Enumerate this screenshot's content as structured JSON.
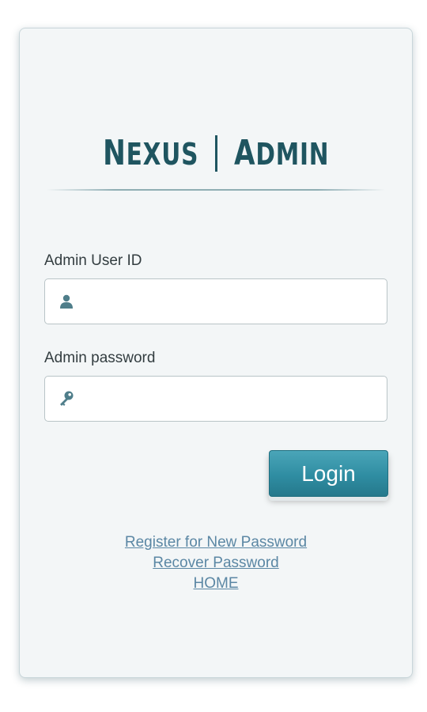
{
  "brand": {
    "first_initial": "N",
    "first_rest": "EXUS",
    "second_initial": "A",
    "second_rest": "DMIN"
  },
  "form": {
    "user_id_label": "Admin User ID",
    "user_id_value": "",
    "password_label": "Admin password",
    "password_value": "",
    "login_label": "Login"
  },
  "links": {
    "register": "Register for New Password",
    "recover": "Recover Password",
    "home": "HOME"
  },
  "icons": {
    "user_field": "user-icon",
    "password_field": "key-icon"
  },
  "colors": {
    "brand": "#1f5560",
    "button": "#2f8da2",
    "link": "#5b87a4",
    "icon": "#4f7e8a"
  }
}
